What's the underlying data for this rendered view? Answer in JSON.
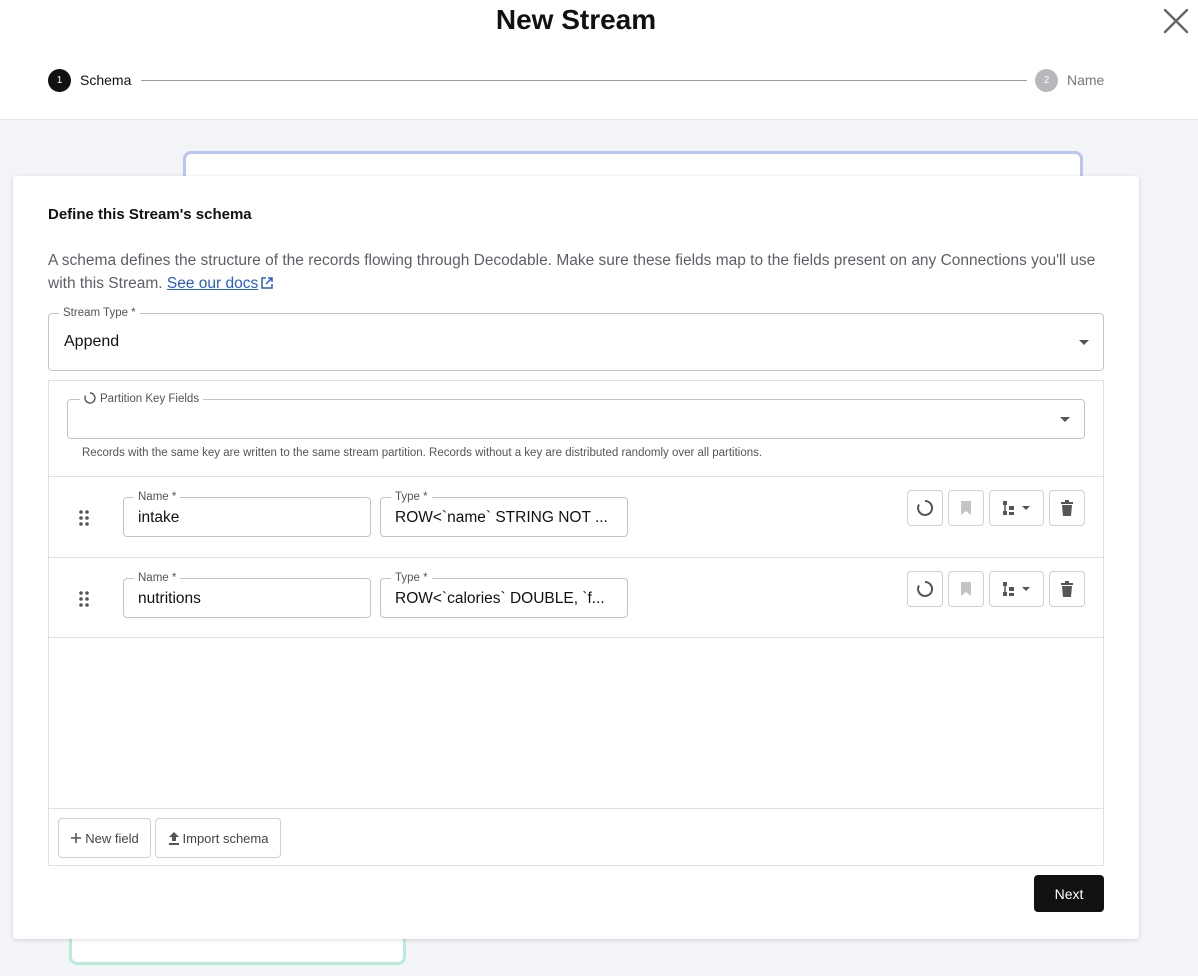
{
  "header": {
    "title": "New Stream",
    "steps": [
      {
        "number": "1",
        "label": "Schema",
        "active": true
      },
      {
        "number": "2",
        "label": "Name",
        "active": false
      }
    ]
  },
  "card": {
    "heading": "Define this Stream's schema",
    "description": "A schema defines the structure of the records flowing through Decodable. Make sure these fields map to the fields present on any Connections you'll use with this Stream. ",
    "docs_link": "See our docs"
  },
  "stream_type": {
    "label": "Stream Type *",
    "value": "Append"
  },
  "partition": {
    "label": "Partition Key Fields",
    "value": "",
    "helper": "Records with the same key are written to the same stream partition. Records without a key are distributed randomly over all partitions."
  },
  "fields": [
    {
      "name_label": "Name *",
      "name": "intake",
      "type_label": "Type *",
      "type": "ROW<`name` STRING NOT ..."
    },
    {
      "name_label": "Name *",
      "name": "nutritions",
      "type_label": "Type *",
      "type": "ROW<`calories` DOUBLE, `f..."
    }
  ],
  "footer": {
    "new_field": "New field",
    "import_schema": "Import schema",
    "next": "Next"
  },
  "colors": {
    "primary": "#111111",
    "link": "#2a5bd7",
    "bg": "#f3f4f8",
    "inactive_step": "#b7b8bc"
  }
}
